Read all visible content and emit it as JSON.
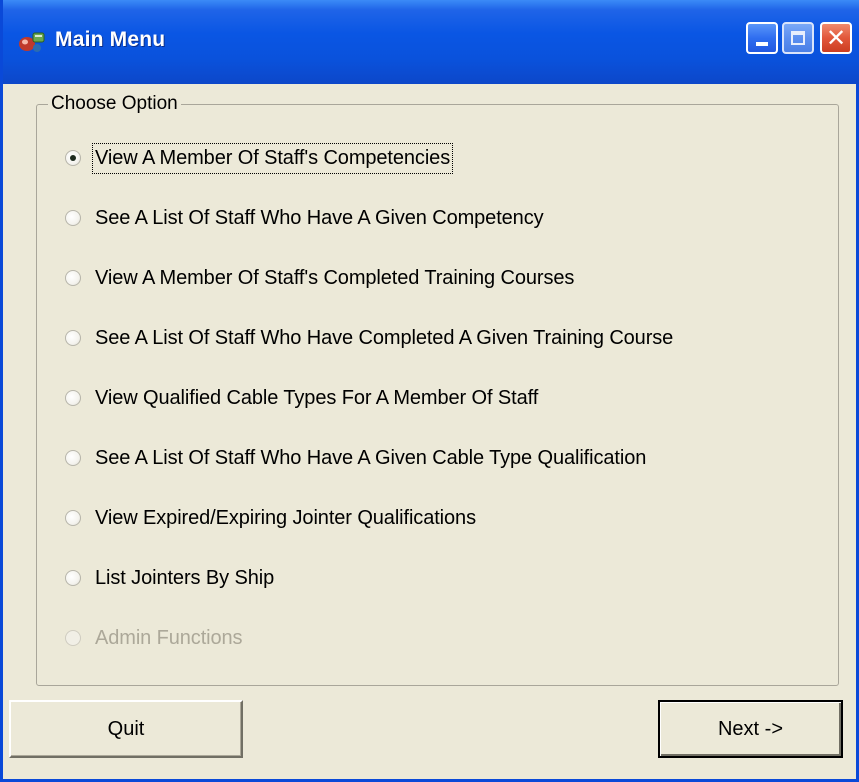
{
  "window": {
    "title": "Main Menu",
    "icon": "app-icon"
  },
  "titlebar_buttons": {
    "minimize": "minimize-icon",
    "maximize": "maximize-icon",
    "close": "close-icon",
    "close_glyph": "✕"
  },
  "group": {
    "legend": "Choose Option",
    "options": [
      {
        "label": "View A Member Of Staff's Competencies",
        "selected": true,
        "enabled": true
      },
      {
        "label": "See A List Of Staff Who Have A Given Competency",
        "selected": false,
        "enabled": true
      },
      {
        "label": "View A Member Of Staff's Completed Training Courses",
        "selected": false,
        "enabled": true
      },
      {
        "label": "See A List Of Staff Who Have Completed A Given Training Course",
        "selected": false,
        "enabled": true
      },
      {
        "label": "View Qualified Cable Types For A Member Of Staff",
        "selected": false,
        "enabled": true
      },
      {
        "label": "See A List Of Staff Who Have A Given Cable Type Qualification",
        "selected": false,
        "enabled": true
      },
      {
        "label": "View Expired/Expiring Jointer Qualifications",
        "selected": false,
        "enabled": true
      },
      {
        "label": "List Jointers By Ship",
        "selected": false,
        "enabled": true
      },
      {
        "label": "Admin Functions",
        "selected": false,
        "enabled": false
      }
    ]
  },
  "buttons": {
    "quit": "Quit",
    "next": "Next ->"
  },
  "colors": {
    "titlebar": "#0a56e4",
    "face": "#ece9d8",
    "disabled_text": "#aca899"
  }
}
